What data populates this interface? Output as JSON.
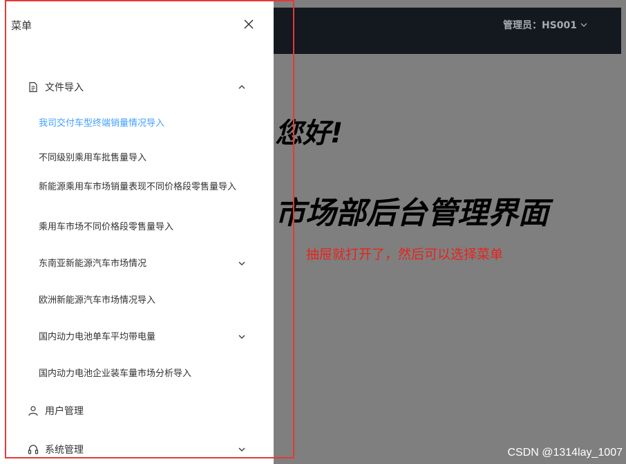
{
  "app": {
    "admin_label": "管理员：HS001",
    "hello": "您好!",
    "title": "市场部后台管理界面",
    "annotation": "抽屉就打开了，然后可以选择菜单"
  },
  "drawer": {
    "title": "菜单",
    "menu": {
      "file_import": "文件导入",
      "sub_items": [
        "我司交付车型终端销量情况导入",
        "不同级别乘用车批售量导入",
        "新能源乘用车市场销量表现不同价格段零售量导入",
        "乘用车市场不同价格段零售量导入",
        "东南亚新能源汽车市场情况",
        "欧洲新能源汽车市场情况导入",
        "国内动力电池单车平均带电量",
        "国内动力电池企业装车量市场分析导入"
      ],
      "user_management": "用户管理",
      "system_management": "系统管理"
    }
  },
  "watermark": "CSDN @1314lay_1007",
  "colors": {
    "active": "#409eff",
    "annotation": "#e8231c",
    "frame": "#e53935"
  }
}
